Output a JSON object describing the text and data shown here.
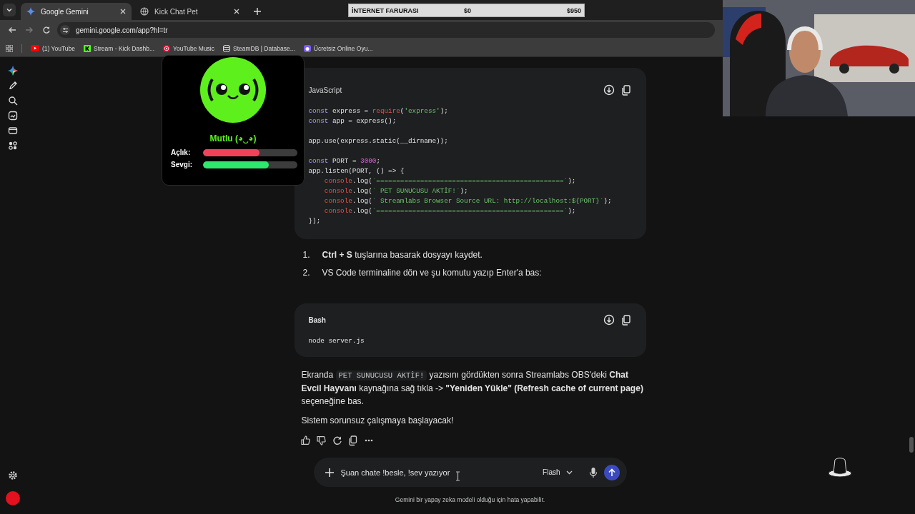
{
  "browser": {
    "tabs": [
      {
        "title": "Google Gemini",
        "selected": true,
        "kind": "gemini"
      },
      {
        "title": "Kick Chat Pet",
        "selected": false,
        "kind": "globe"
      }
    ],
    "url": "gemini.google.com/app?hl=tr",
    "bookmarks": [
      {
        "label": "(1) YouTube",
        "kind": "play"
      },
      {
        "label": "Stream - Kick Dashb...",
        "kind": "k"
      },
      {
        "label": "YouTube Music",
        "kind": "music"
      },
      {
        "label": "SteamDB | Database...",
        "kind": "stack"
      },
      {
        "label": "Ücretsiz Online Oyu...",
        "kind": "game"
      }
    ]
  },
  "goal_widget": {
    "label": "İNTERNET FARURASI",
    "start": "$0",
    "goal": "$950"
  },
  "pet_overlay": {
    "mood": "Mutlu (◕‿◕)",
    "meters": [
      {
        "label": "Açlık:",
        "level": 0.6,
        "kind": "hunger"
      },
      {
        "label": "Sevgi:",
        "level": 0.7,
        "kind": "love"
      }
    ]
  },
  "code_block": {
    "language": "JavaScript",
    "lines": [
      {
        "kind": "code",
        "tokens": [
          {
            "t": "const",
            "kind": "kw"
          },
          {
            "t": " express = ",
            "kind": "p"
          },
          {
            "t": "require",
            "kind": "fn"
          },
          {
            "t": "(",
            "kind": "p"
          },
          {
            "t": "'express'",
            "kind": "str"
          },
          {
            "t": ");",
            "kind": "p"
          }
        ]
      },
      {
        "kind": "code",
        "tokens": [
          {
            "t": "const",
            "kind": "kw"
          },
          {
            "t": " app = express();",
            "kind": "p"
          }
        ]
      },
      {
        "kind": "blank"
      },
      {
        "kind": "code",
        "tokens": [
          {
            "t": "app.use(express.static(__dirname));",
            "kind": "p"
          }
        ]
      },
      {
        "kind": "blank"
      },
      {
        "kind": "code",
        "tokens": [
          {
            "t": "const",
            "kind": "kw"
          },
          {
            "t": " PORT = ",
            "kind": "p"
          },
          {
            "t": "3000",
            "kind": "num"
          },
          {
            "t": ";",
            "kind": "p"
          }
        ]
      },
      {
        "kind": "code",
        "tokens": [
          {
            "t": "app.listen(PORT, () => {",
            "kind": "p"
          }
        ]
      },
      {
        "kind": "indented",
        "tokens": [
          {
            "t": "console",
            "kind": "fn"
          },
          {
            "t": ".log(",
            "kind": "p"
          },
          {
            "t": "`===============================================`",
            "kind": "str"
          },
          {
            "t": ");",
            "kind": "p"
          }
        ]
      },
      {
        "kind": "indented",
        "tokens": [
          {
            "t": "console",
            "kind": "fn"
          },
          {
            "t": ".log(",
            "kind": "p"
          },
          {
            "t": "` PET SUNUCUSU AKTİF!`",
            "kind": "str"
          },
          {
            "t": ");",
            "kind": "p"
          }
        ]
      },
      {
        "kind": "indented",
        "tokens": [
          {
            "t": "console",
            "kind": "fn"
          },
          {
            "t": ".log(",
            "kind": "p"
          },
          {
            "t": "` Streamlabs Browser Source URL: http://localhost:${PORT}`",
            "kind": "str"
          },
          {
            "t": ");",
            "kind": "p"
          }
        ]
      },
      {
        "kind": "indented",
        "tokens": [
          {
            "t": "console",
            "kind": "fn"
          },
          {
            "t": ".log(",
            "kind": "p"
          },
          {
            "t": "`===============================================`",
            "kind": "str"
          },
          {
            "t": ");",
            "kind": "p"
          }
        ]
      },
      {
        "kind": "code",
        "tokens": [
          {
            "t": "});",
            "kind": "p"
          }
        ]
      }
    ]
  },
  "steps": [
    {
      "number": "1.",
      "text": "**Ctrl + S** tuşlarına basarak dosyayı kaydet."
    },
    {
      "number": "2.",
      "text": "VS Code terminaline dön ve şu komutu yazıp Enter'a bas:"
    }
  ],
  "command_block": {
    "language": "Bash",
    "lines": [
      {
        "kind": "code",
        "tokens": [
          {
            "t": "node server.js",
            "kind": "p"
          }
        ]
      }
    ]
  },
  "paragraphs": [
    {
      "segments": [
        {
          "kind": "text",
          "text": "Ekranda "
        },
        {
          "kind": "code",
          "text": "PET SUNUCUSU AKTİF!"
        },
        {
          "kind": "text",
          "text": " yazısını gördükten sonra Streamlabs OBS'deki **Chat Evcil Hayvanı** kaynağına sağ tıkla -> **\"Yeniden Yükle\" (Refresh cache of current page)** seçeneğine bas."
        }
      ]
    },
    {
      "segments": [
        {
          "kind": "text",
          "text": "Sistem sorunsuz çalışmaya başlayacak!"
        }
      ]
    }
  ],
  "composer": {
    "value": "Şuan chate !besle, !sev yazıyor",
    "model": "Flash"
  },
  "disclaimer": "Gemini bir yapay zeka modeli olduğu için hata yapabilir."
}
